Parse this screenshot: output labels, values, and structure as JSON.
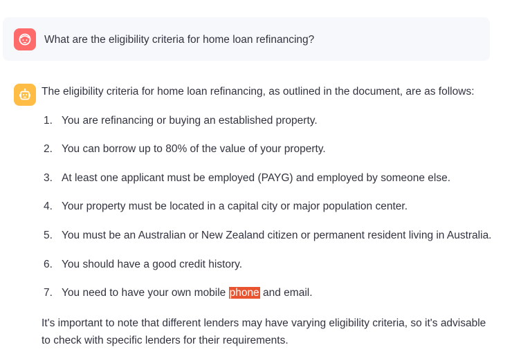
{
  "chat": {
    "user": {
      "avatar_icon": "user-face-icon",
      "avatar_color": "#ff6b6b",
      "message": "What are the eligibility criteria for home loan refinancing?"
    },
    "assistant": {
      "avatar_icon": "robot-icon",
      "avatar_color": "#ffbd45",
      "intro": "The eligibility criteria for home loan refinancing, as outlined in the document, are as follows:",
      "items": [
        {
          "num": "1.",
          "text": "You are refinancing or buying an established property."
        },
        {
          "num": "2.",
          "text": "You can borrow up to 80% of the value of your property."
        },
        {
          "num": "3.",
          "text": "At least one applicant must be employed (PAYG) and employed by someone else."
        },
        {
          "num": "4.",
          "text": "Your property must be located in a capital city or major population center."
        },
        {
          "num": "5.",
          "text": "You must be an Australian or New Zealand citizen or permanent resident living in Australia."
        },
        {
          "num": "6.",
          "text": "You should have a good credit history."
        },
        {
          "num": "7.",
          "text_before": "You need to have your own mobile ",
          "highlight": "phone",
          "text_after": " and email."
        }
      ],
      "highlight_color": "#e8542f",
      "outro": "It's important to note that different lenders may have varying eligibility criteria, so it's advisable to check with specific lenders for their requirements."
    }
  }
}
